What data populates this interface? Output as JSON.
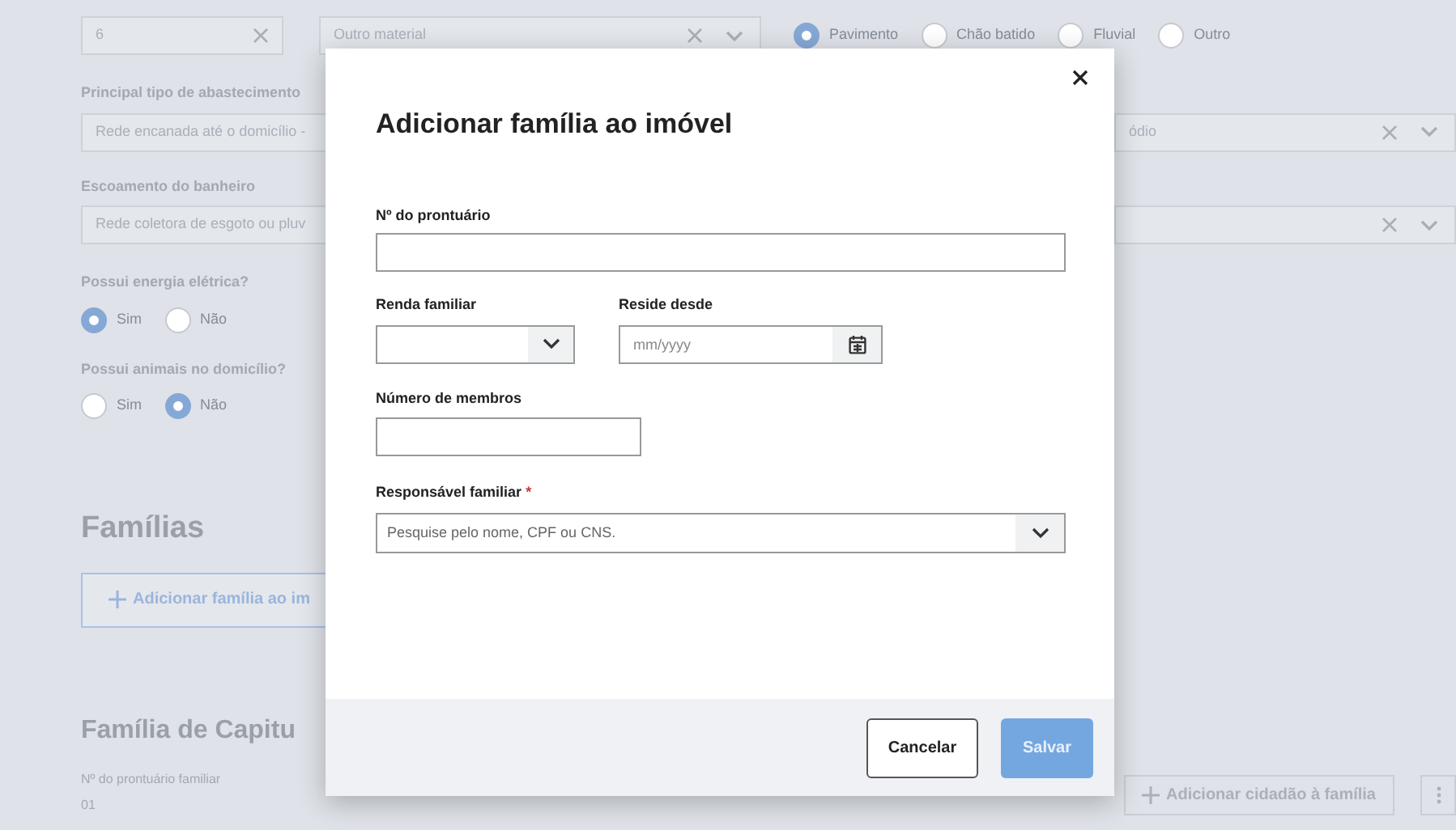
{
  "background_form": {
    "top_row": {
      "count_field": {
        "value": "6"
      },
      "material_select": {
        "value": "Outro material"
      },
      "surface_radios": [
        {
          "label": "Pavimento",
          "selected": true
        },
        {
          "label": "Chão batido",
          "selected": false
        },
        {
          "label": "Fluvial",
          "selected": false
        },
        {
          "label": "Outro",
          "selected": false
        }
      ]
    },
    "water_supply": {
      "label": "Principal tipo de abastecimento",
      "value": "Rede encanada até o domicílio -",
      "right_value": "ódio"
    },
    "bathroom_drain": {
      "label": "Escoamento do banheiro",
      "value": "Rede coletora de esgoto ou pluv"
    },
    "electricity": {
      "label": "Possui energia elétrica?",
      "options": [
        {
          "label": "Sim",
          "selected": true
        },
        {
          "label": "Não",
          "selected": false
        }
      ]
    },
    "animals": {
      "label": "Possui animais no domicílio?",
      "options": [
        {
          "label": "Sim",
          "selected": false
        },
        {
          "label": "Não",
          "selected": true
        }
      ]
    },
    "families_heading": "Famílias",
    "add_family_button": "Adicionar família ao im",
    "family": {
      "title": "Família de Capitu",
      "record_label": "Nº do prontuário familiar",
      "record_value": "01",
      "add_citizen_button": "Adicionar cidadão à família"
    }
  },
  "modal": {
    "title": "Adicionar família ao imóvel",
    "record_field": {
      "label": "Nº do prontuário"
    },
    "income_select": {
      "label": "Renda familiar"
    },
    "since_field": {
      "label": "Reside desde",
      "placeholder": "mm/yyyy"
    },
    "members_field": {
      "label": "Número de membros"
    },
    "responsible_select": {
      "label": "Responsável familiar",
      "required_mark": "*",
      "placeholder": "Pesquise pelo nome, CPF ou CNS."
    },
    "buttons": [
      {
        "label": "Cancelar",
        "kind": "secondary",
        "disabled": false
      },
      {
        "label": "Salvar",
        "kind": "primary",
        "disabled": true
      }
    ]
  }
}
